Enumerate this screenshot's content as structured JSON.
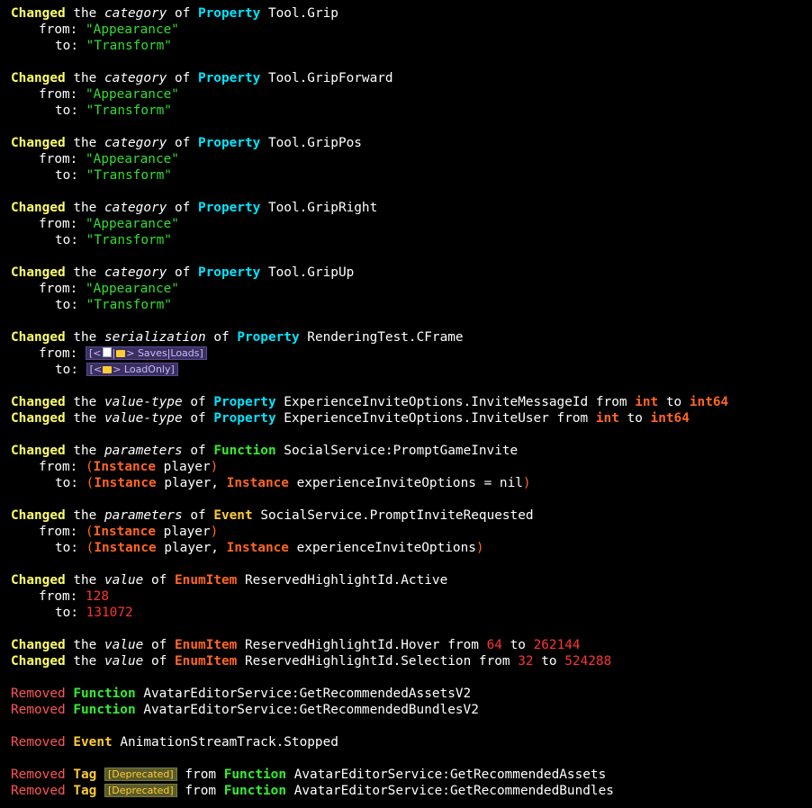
{
  "colors": {
    "background": "#000000",
    "changed": "#ffff66",
    "removed": "#ff5555",
    "property": "#00e5ff",
    "function": "#33ee33",
    "event": "#ffcc33",
    "enumitem": "#ff6622",
    "string": "#33dd33",
    "number": "#ff3333"
  },
  "kw": {
    "changed": "Changed",
    "removed": "Removed",
    "the": "the",
    "of": "of",
    "from_kw": "from",
    "to_kw": "to",
    "from_label": "from:",
    "to_label": "to:",
    "category": "category",
    "serialization": "serialization",
    "value_type": "value-type",
    "parameters": "parameters",
    "value": "value",
    "property": "Property",
    "function": "Function",
    "event": "Event",
    "enumitem": "EnumItem",
    "tag": "Tag",
    "instance": "Instance",
    "deprecated": "[Deprecated]"
  },
  "grip": {
    "name": "Tool.Grip",
    "from": "\"Appearance\"",
    "to": "\"Transform\""
  },
  "gripforward": {
    "name": "Tool.GripForward",
    "from": "\"Appearance\"",
    "to": "\"Transform\""
  },
  "grippos": {
    "name": "Tool.GripPos",
    "from": "\"Appearance\"",
    "to": "\"Transform\""
  },
  "gripright": {
    "name": "Tool.GripRight",
    "from": "\"Appearance\"",
    "to": "\"Transform\""
  },
  "gripup": {
    "name": "Tool.GripUp",
    "from": "\"Appearance\"",
    "to": "\"Transform\""
  },
  "cframe": {
    "name": "RenderingTest.CFrame",
    "from_open": "[<",
    "from_sep": "|",
    "from_arrow": ">",
    "from_text": "Saves|Loads]",
    "to_open": "[<",
    "to_arrow": ">",
    "to_text": "LoadOnly]",
    "floppy_icon": "floppy-disk-icon",
    "folder_icon": "folder-icon"
  },
  "msgid": {
    "name": "ExperienceInviteOptions.InviteMessageId",
    "from": "int",
    "to": "int64"
  },
  "inviteuser": {
    "name": "ExperienceInviteOptions.InviteUser",
    "from": "int",
    "to": "int64"
  },
  "promptgame": {
    "name": "SocialService:PromptGameInvite",
    "from_param": "player",
    "to_param1": "player,",
    "to_param2": "experienceInviteOptions = nil"
  },
  "promptreq": {
    "name": "SocialService.PromptInviteRequested",
    "from_param": "player",
    "to_param1": "player,",
    "to_param2": "experienceInviteOptions"
  },
  "active": {
    "name": "ReservedHighlightId.Active",
    "from": "128",
    "to": "131072"
  },
  "hover": {
    "name": "ReservedHighlightId.Hover",
    "from": "64",
    "to": "262144"
  },
  "selection": {
    "name": "ReservedHighlightId.Selection",
    "from": "32",
    "to": "524288"
  },
  "removed": {
    "assetsv2": "AvatarEditorService:GetRecommendedAssetsV2",
    "bundlesv2": "AvatarEditorService:GetRecommendedBundlesV2",
    "stopped": "AnimationStreamTrack.Stopped",
    "assets": "AvatarEditorService:GetRecommendedAssets",
    "bundles": "AvatarEditorService:GetRecommendedBundles"
  }
}
